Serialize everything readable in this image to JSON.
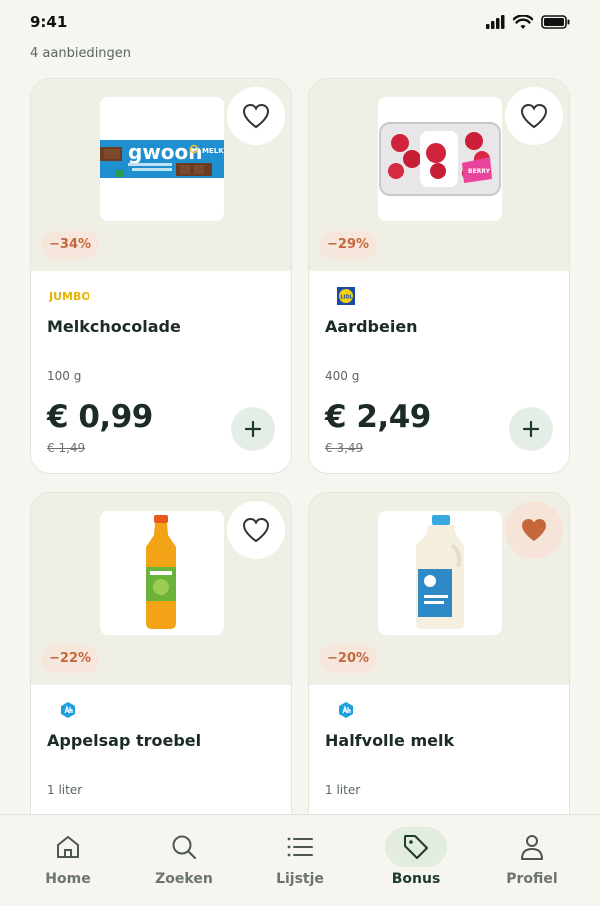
{
  "status_bar": {
    "time": "9:41"
  },
  "results": {
    "count_label": "4 aanbiedingen"
  },
  "products": [
    {
      "name": "Melkchocolade",
      "quantity": "100 g",
      "price": "€ 0,99",
      "old_price": "€ 1,49",
      "discount": "−34%",
      "store": "Jumbo",
      "store_logo_text": "JUMBO",
      "brand_text": "gwoon",
      "favorited": false
    },
    {
      "name": "Aardbeien",
      "quantity": "400 g",
      "price": "€ 2,49",
      "old_price": "€ 3,49",
      "discount": "−29%",
      "store": "Lidl",
      "store_logo_text": "LIDL",
      "favorited": false
    },
    {
      "name": "Appelsap troebel",
      "quantity": "1 liter",
      "price": "",
      "old_price": "",
      "discount": "−22%",
      "store": "Albert Heijn",
      "favorited": false
    },
    {
      "name": "Halfvolle melk",
      "quantity": "1 liter",
      "price": "",
      "old_price": "",
      "discount": "−20%",
      "store": "Albert Heijn",
      "favorited": true
    }
  ],
  "bottom_nav": {
    "items": [
      {
        "label": "Home",
        "icon": "home-icon",
        "active": false
      },
      {
        "label": "Zoeken",
        "icon": "search-icon",
        "active": false
      },
      {
        "label": "Lijstje",
        "icon": "list-icon",
        "active": false
      },
      {
        "label": "Bonus",
        "icon": "tag-icon",
        "active": true
      },
      {
        "label": "Profiel",
        "icon": "profile-icon",
        "active": false
      }
    ]
  },
  "colors": {
    "background": "#f6f5ef",
    "accent_dark_green": "#1c3a2d",
    "discount_orange": "#c4673a",
    "active_nav_bg": "#e2ecdf",
    "favorite_fill": "#c4673a"
  }
}
